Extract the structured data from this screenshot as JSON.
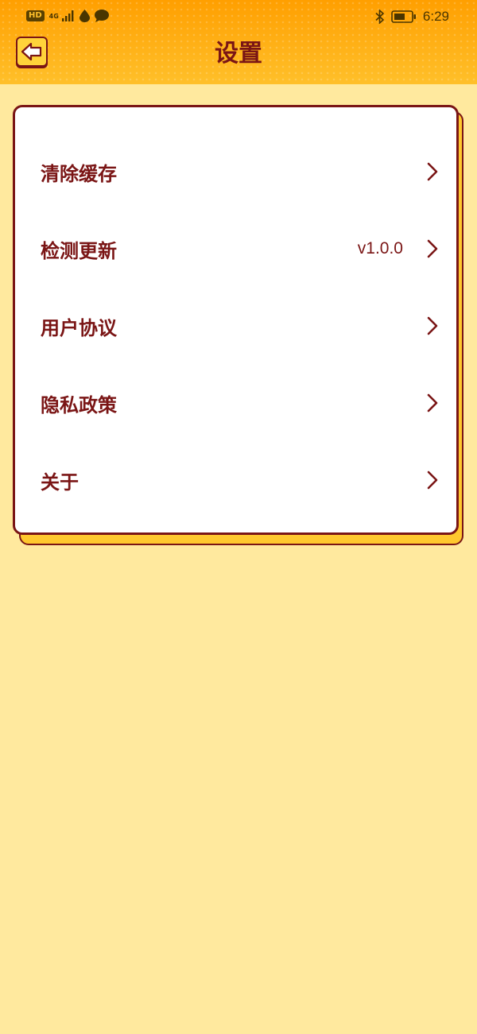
{
  "status_bar": {
    "hd_label": "HD",
    "network_label": "4G",
    "time": "6:29",
    "icons": [
      "signal-icon",
      "water-drop-icon",
      "chat-bubble-icon",
      "bluetooth-icon",
      "battery-icon"
    ]
  },
  "header": {
    "title": "设置",
    "back_icon": "back-arrow-icon"
  },
  "menu": {
    "items": [
      {
        "label": "清除缓存",
        "value": ""
      },
      {
        "label": "检测更新",
        "value": "v1.0.0"
      },
      {
        "label": "用户协议",
        "value": ""
      },
      {
        "label": "隐私政策",
        "value": ""
      },
      {
        "label": "关于",
        "value": ""
      }
    ],
    "chevron_icon": "chevron-right-icon"
  },
  "colors": {
    "header_orange": "#FFAE12",
    "page_background": "#FFE99E",
    "accent_dark_red": "#7A1515",
    "card_shadow_yellow": "#FFC82E",
    "back_button_yellow": "#FFD33A"
  }
}
